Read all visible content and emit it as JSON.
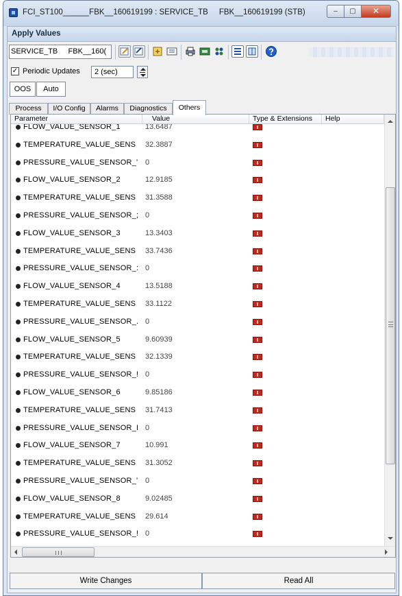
{
  "window": {
    "title": "FCI_ST100______FBK__160619199 : SERVICE_TB     FBK__160619199 (STB)",
    "min_glyph": "–",
    "max_glyph": "▢",
    "close_glyph": "✕"
  },
  "header": {
    "title": "Apply Values"
  },
  "toolbar": {
    "block_select_value": "SERVICE_TB     FBK__160(",
    "icons": [
      "edit-icon",
      "edit-all-icon",
      "method-icon",
      "compare-icon",
      "print-icon",
      "transfer-icon",
      "config-icon",
      "list-view-icon",
      "grid-view-icon",
      "help-icon"
    ]
  },
  "periodic": {
    "checked_glyph": "✓",
    "label": "Periodic Updates",
    "interval": "2 (sec)"
  },
  "mode": {
    "oos_label": "OOS",
    "auto_label": "Auto"
  },
  "tabs": [
    {
      "label": "Process"
    },
    {
      "label": "I/O Config"
    },
    {
      "label": "Alarms"
    },
    {
      "label": "Diagnostics"
    },
    {
      "label": "Others",
      "active": true
    }
  ],
  "table": {
    "headers": {
      "parameter": "Parameter",
      "value": "Value",
      "type": "Type & Extensions",
      "help": "Help"
    },
    "rows": [
      {
        "name": "FLOW_VALUE_SENSOR_1",
        "value": "13.6487"
      },
      {
        "name": "TEMPERATURE_VALUE_SENS",
        "value": "32.3887"
      },
      {
        "name": "PRESSURE_VALUE_SENSOR_'",
        "value": "0"
      },
      {
        "name": "FLOW_VALUE_SENSOR_2",
        "value": "12.9185"
      },
      {
        "name": "TEMPERATURE_VALUE_SENS",
        "value": "31.3588"
      },
      {
        "name": "PRESSURE_VALUE_SENSOR_;",
        "value": "0"
      },
      {
        "name": "FLOW_VALUE_SENSOR_3",
        "value": "13.3403"
      },
      {
        "name": "TEMPERATURE_VALUE_SENS",
        "value": "33.7436"
      },
      {
        "name": "PRESSURE_VALUE_SENSOR_:",
        "value": "0"
      },
      {
        "name": "FLOW_VALUE_SENSOR_4",
        "value": "13.5188"
      },
      {
        "name": "TEMPERATURE_VALUE_SENS",
        "value": "33.1122"
      },
      {
        "name": "PRESSURE_VALUE_SENSOR_.",
        "value": "0"
      },
      {
        "name": "FLOW_VALUE_SENSOR_5",
        "value": "9.60939"
      },
      {
        "name": "TEMPERATURE_VALUE_SENS",
        "value": "32.1339"
      },
      {
        "name": "PRESSURE_VALUE_SENSOR_!",
        "value": "0"
      },
      {
        "name": "FLOW_VALUE_SENSOR_6",
        "value": "9.85186"
      },
      {
        "name": "TEMPERATURE_VALUE_SENS",
        "value": "31.7413"
      },
      {
        "name": "PRESSURE_VALUE_SENSOR_I",
        "value": "0"
      },
      {
        "name": "FLOW_VALUE_SENSOR_7",
        "value": "10.991"
      },
      {
        "name": "TEMPERATURE_VALUE_SENS",
        "value": "31.3052"
      },
      {
        "name": "PRESSURE_VALUE_SENSOR_'",
        "value": "0"
      },
      {
        "name": "FLOW_VALUE_SENSOR_8",
        "value": "9.02485"
      },
      {
        "name": "TEMPERATURE_VALUE_SENS",
        "value": "29.614"
      },
      {
        "name": "PRESSURE_VALUE_SENSOR_!",
        "value": "0"
      }
    ]
  },
  "hscroll": {
    "grip_glyph": "III"
  },
  "footer": {
    "write_label": "Write Changes",
    "read_label": "Read All"
  },
  "colors": {
    "accent": "#1f4f9e",
    "ext_icon": "#c0281d",
    "close_button": "#c43b1f"
  }
}
